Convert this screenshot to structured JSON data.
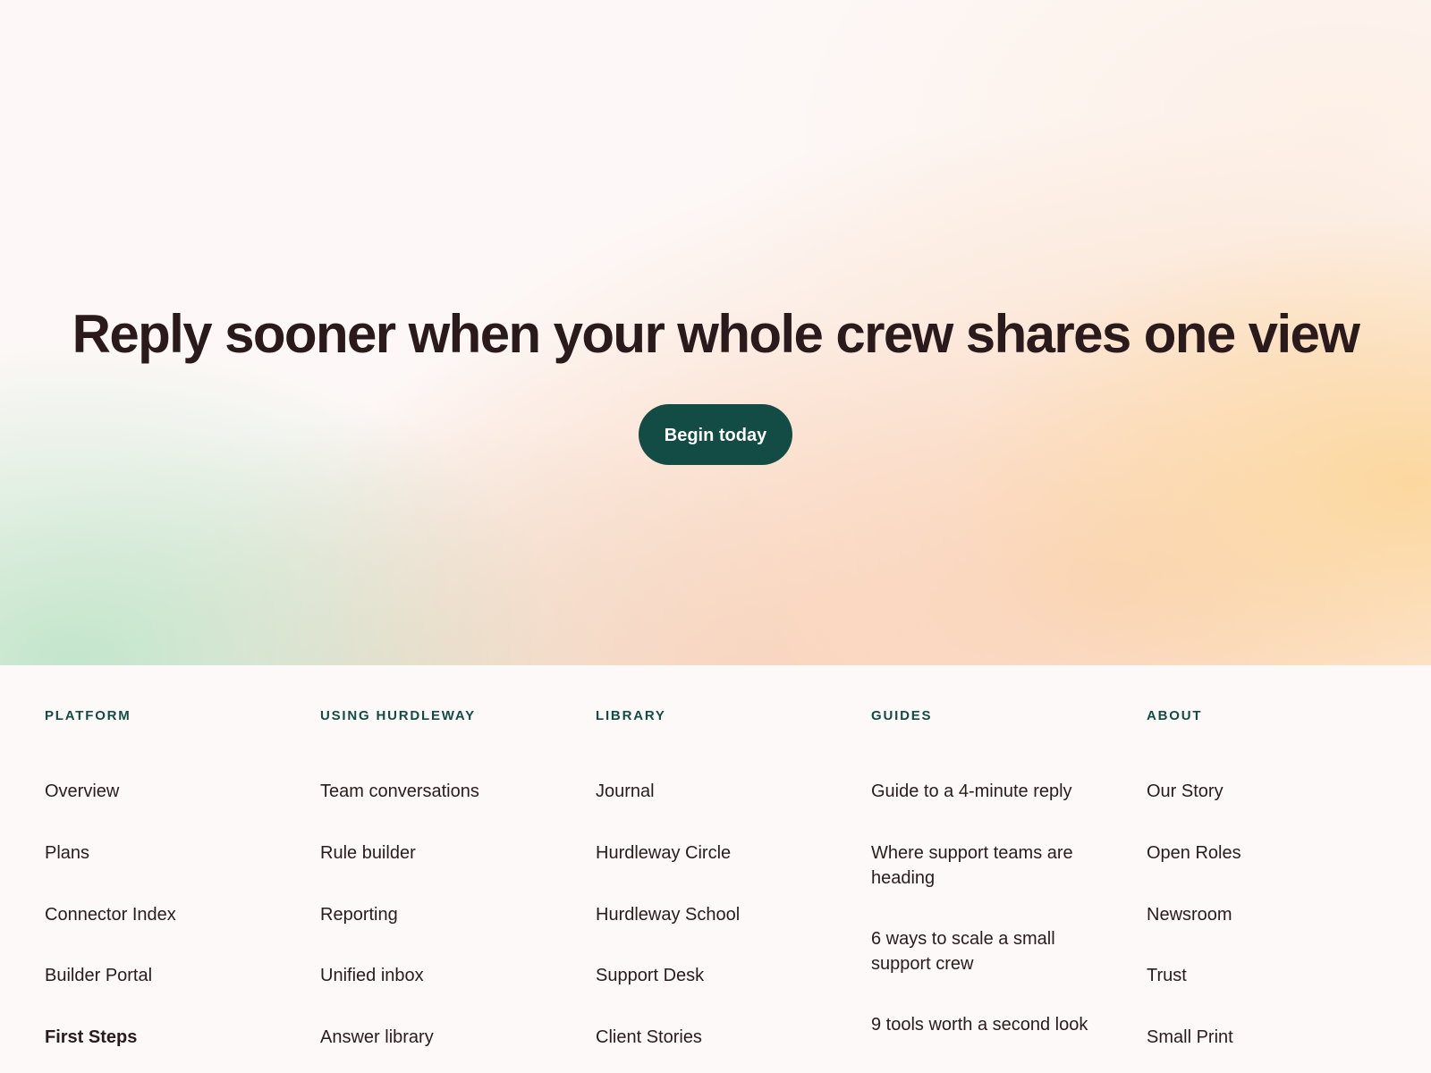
{
  "hero": {
    "headline": "Reply sooner when your whole crew shares one view",
    "cta_label": "Begin today"
  },
  "footer": {
    "columns": [
      {
        "heading": "PLATFORM",
        "links": [
          "Overview",
          "Plans",
          "Connector Index",
          "Builder Portal",
          "First Steps"
        ]
      },
      {
        "heading": "USING HURDLEWAY",
        "links": [
          "Team conversations",
          "Rule builder",
          "Reporting",
          "Unified inbox",
          "Answer library"
        ]
      },
      {
        "heading": "LIBRARY",
        "links": [
          "Journal",
          "Hurdleway Circle",
          "Hurdleway School",
          "Support Desk",
          "Client Stories"
        ]
      },
      {
        "heading": "GUIDES",
        "links": [
          "Guide to a 4-minute reply",
          "Where support teams are heading",
          "6 ways to scale a small support crew",
          "9 tools worth a second look"
        ]
      },
      {
        "heading": "ABOUT",
        "links": [
          "Our Story",
          "Open Roles",
          "Newsroom",
          "Trust",
          "Small Print"
        ]
      }
    ]
  },
  "colors": {
    "accent": "#124c44",
    "text": "#2a1a1b",
    "background": "#fcf9f8"
  }
}
